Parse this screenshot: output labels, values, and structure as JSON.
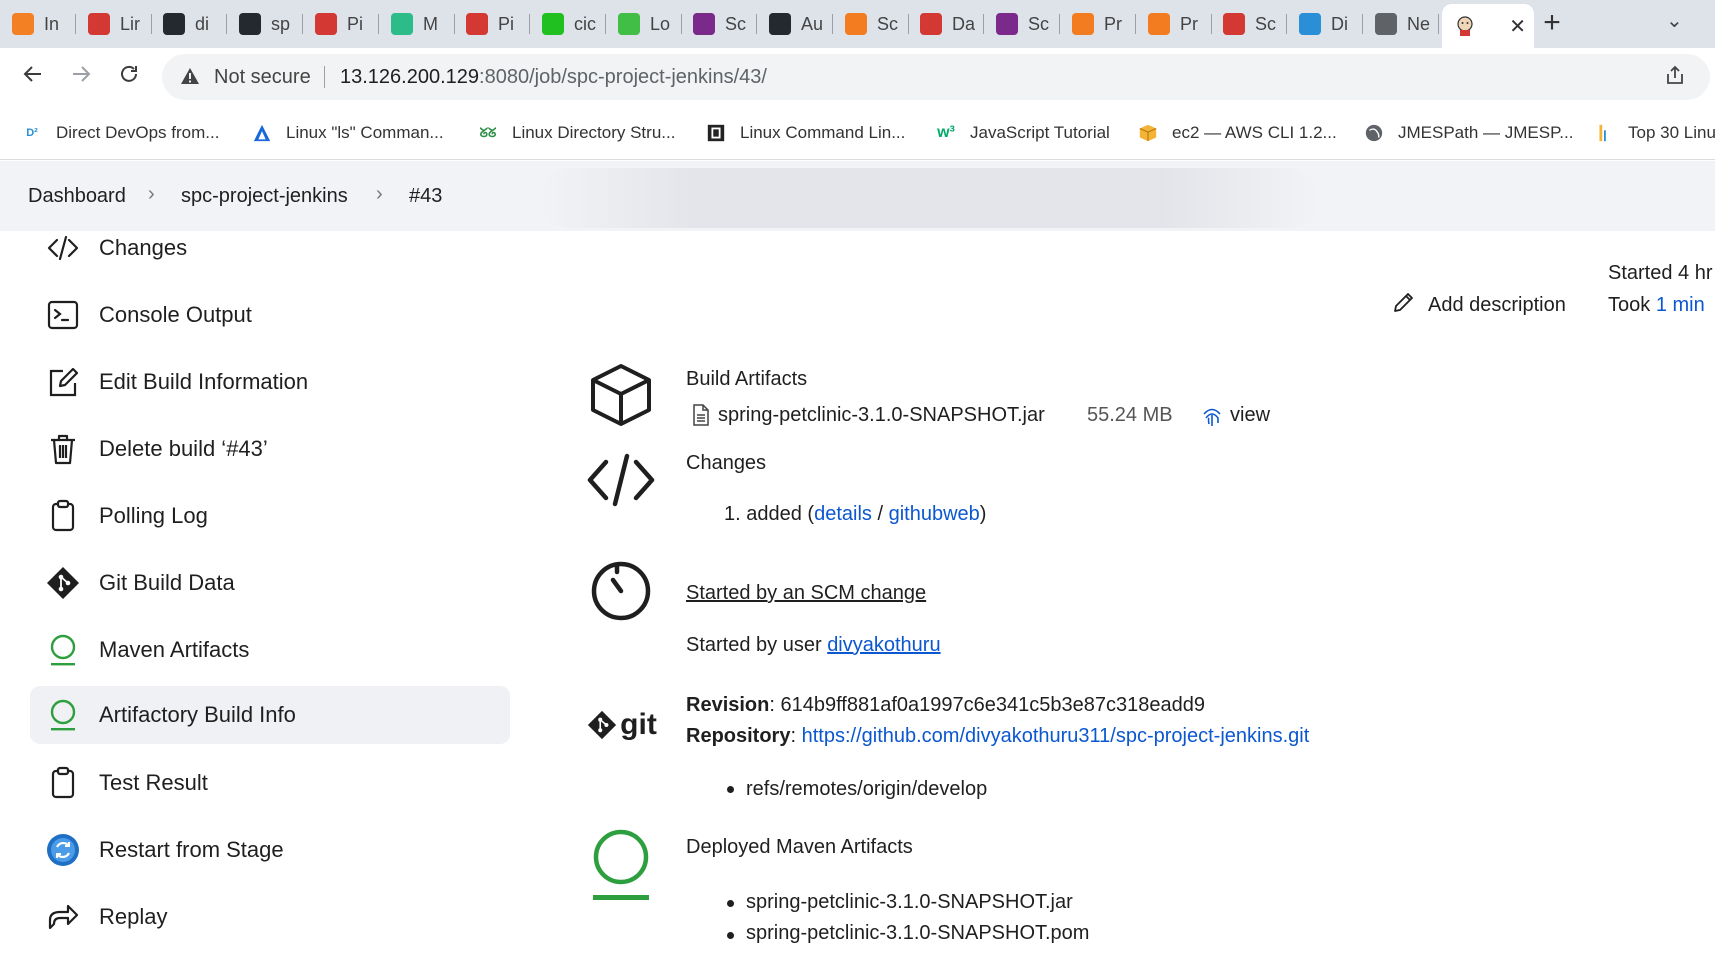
{
  "browser": {
    "tabs": [
      {
        "label": "In",
        "icon": "stackoverflow-icon",
        "color": "#f48024"
      },
      {
        "label": "Lir",
        "icon": "jenkins-icon",
        "color": "#d33833"
      },
      {
        "label": "di",
        "icon": "github-icon",
        "color": "#24292f"
      },
      {
        "label": "sp",
        "icon": "github-icon",
        "color": "#24292f"
      },
      {
        "label": "Pi",
        "icon": "jenkins-icon",
        "color": "#d33833"
      },
      {
        "label": "M",
        "icon": "mkdocs-icon",
        "color": "#2bbc8a"
      },
      {
        "label": "Pi",
        "icon": "jenkins-icon",
        "color": "#d33833"
      },
      {
        "label": "cic",
        "icon": "circle-bolt-icon",
        "color": "#1fc01f"
      },
      {
        "label": "Lo",
        "icon": "jfrog-icon",
        "color": "#40be46"
      },
      {
        "label": "Sc",
        "icon": "sonar-icon",
        "color": "#7b2a8c"
      },
      {
        "label": "Au",
        "icon": "github-icon",
        "color": "#24292f"
      },
      {
        "label": "Sc",
        "icon": "cloud-icon",
        "color": "#f47c20"
      },
      {
        "label": "Da",
        "icon": "jenkins-icon",
        "color": "#d33833"
      },
      {
        "label": "Sc",
        "icon": "sonar-icon",
        "color": "#7b2a8c"
      },
      {
        "label": "Pr",
        "icon": "cloud-icon",
        "color": "#f47c20"
      },
      {
        "label": "Pr",
        "icon": "cloud-icon",
        "color": "#f47c20"
      },
      {
        "label": "Sc",
        "icon": "jenkins-icon",
        "color": "#d33833"
      },
      {
        "label": "Di",
        "icon": "direct-devops-icon",
        "color": "#2a8fd6"
      },
      {
        "label": "Ne",
        "icon": "chrome-icon",
        "color": "#5f6368"
      }
    ],
    "active_tab_icon": "jenkins-icon",
    "new_tab_symbol": "+",
    "tab_search_symbol": "⌄",
    "not_secure_label": "Not secure",
    "url_host": "13.126.200.129",
    "url_rest": ":8080/job/spc-project-jenkins/43/",
    "bookmarks": [
      {
        "label": "Direct DevOps from...",
        "icon": "direct-devops-icon"
      },
      {
        "label": "Linux \"ls\" Comman...",
        "icon": "atlassian-icon"
      },
      {
        "label": "Linux Directory Stru...",
        "icon": "geeksforgeeks-icon"
      },
      {
        "label": "Linux Command Lin...",
        "icon": "terminal-icon"
      },
      {
        "label": "JavaScript Tutorial",
        "icon": "w3schools-icon"
      },
      {
        "label": "ec2 — AWS CLI 1.2...",
        "icon": "aws-box-icon"
      },
      {
        "label": "JMESPath — JMESP...",
        "icon": "globe-icon"
      },
      {
        "label": "Top 30 Linu",
        "icon": "bar-icon"
      }
    ]
  },
  "breadcrumb": {
    "items": [
      "Dashboard",
      "spc-project-jenkins",
      "#43"
    ],
    "separator": "›"
  },
  "sidebar": {
    "items": [
      {
        "label": "Changes",
        "icon": "code-icon"
      },
      {
        "label": "Console Output",
        "icon": "terminal-icon"
      },
      {
        "label": "Edit Build Information",
        "icon": "edit-icon"
      },
      {
        "label": "Delete build ‘#43’",
        "icon": "trash-icon"
      },
      {
        "label": "Polling Log",
        "icon": "clipboard-icon"
      },
      {
        "label": "Git Build Data",
        "icon": "git-icon"
      },
      {
        "label": "Maven Artifacts",
        "icon": "maven-circle-icon"
      },
      {
        "label": "Artifactory Build Info",
        "icon": "maven-circle-icon"
      },
      {
        "label": "Test Result",
        "icon": "clipboard-icon"
      },
      {
        "label": "Restart from Stage",
        "icon": "restart-icon"
      },
      {
        "label": "Replay",
        "icon": "replay-icon"
      }
    ],
    "active_index": 7
  },
  "build_meta": {
    "started": "Started 4 hr",
    "took_prefix": "Took ",
    "took_value": "1 min"
  },
  "add_description": "Add description",
  "artifacts": {
    "title": "Build Artifacts",
    "file": "spring-petclinic-3.1.0-SNAPSHOT.jar",
    "size": "55.24 MB",
    "view": "view"
  },
  "changes": {
    "title": "Changes",
    "item_number": "1.",
    "item_text": "added (",
    "details": "details",
    "slash": " / ",
    "githubweb": "githubweb",
    "close_paren": ")"
  },
  "cause": {
    "title": "Started by an SCM change",
    "user_prefix": "Started by user ",
    "user": "divyakothuru"
  },
  "git": {
    "logo_text": "git",
    "revision_label": "Revision",
    "revision": ": 614b9ff881af0a1997c6e341c5b3e87c318eadd9",
    "repository_label": "Repository",
    "repository_colon": ": ",
    "repository_url": "https://github.com/divyakothuru311/spc-project-jenkins.git",
    "branch": "refs/remotes/origin/develop"
  },
  "maven": {
    "title": "Deployed Maven Artifacts",
    "artifacts": [
      "spring-petclinic-3.1.0-SNAPSHOT.jar",
      "spring-petclinic-3.1.0-SNAPSHOT.pom"
    ]
  },
  "colors": {
    "link": "#0b57d0",
    "maven_green": "#2e9f3e",
    "tabstrip": "#dee3ea",
    "breadcrumb_bg": "#f2f3f6"
  }
}
